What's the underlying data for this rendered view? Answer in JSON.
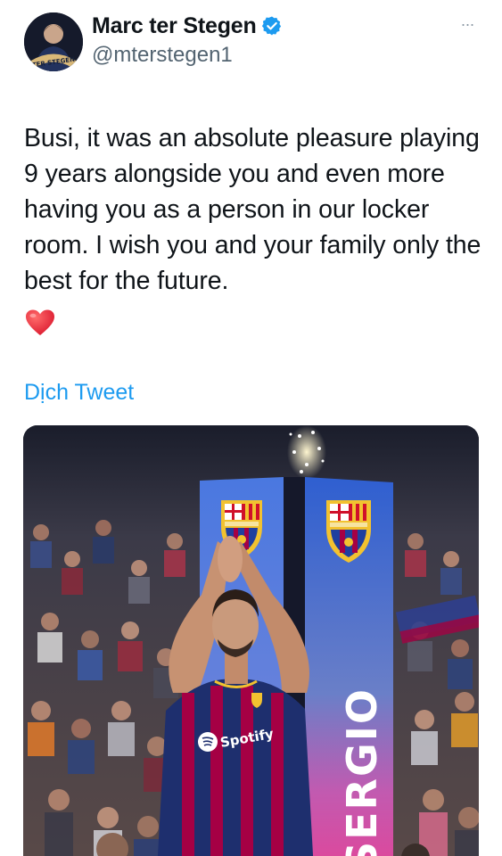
{
  "tweet": {
    "display_name": "Marc ter Stegen",
    "handle": "@mterstegen1",
    "avatar_text": "TER STEGEN",
    "more_label": "···",
    "body": "Busi, it was an absolute pleasure playing 9 years alongside you and even more having you as a person in our locker room. I wish you and your family only the best for the future.",
    "emoji": "heart-emoji",
    "translate_label": "Dịch Tweet"
  },
  "media": {
    "pillar_text": "SERGIO",
    "sponsor_text": "Spotify"
  },
  "colors": {
    "link": "#1d9bf0",
    "verified": "#1d9bf0",
    "handle": "#536471",
    "heart": "#e0245e",
    "blaugrana_blue": "#1f3f8f",
    "blaugrana_red": "#a50044"
  },
  "icons": {
    "verified": "verified-badge-icon",
    "more": "more-options-icon"
  }
}
